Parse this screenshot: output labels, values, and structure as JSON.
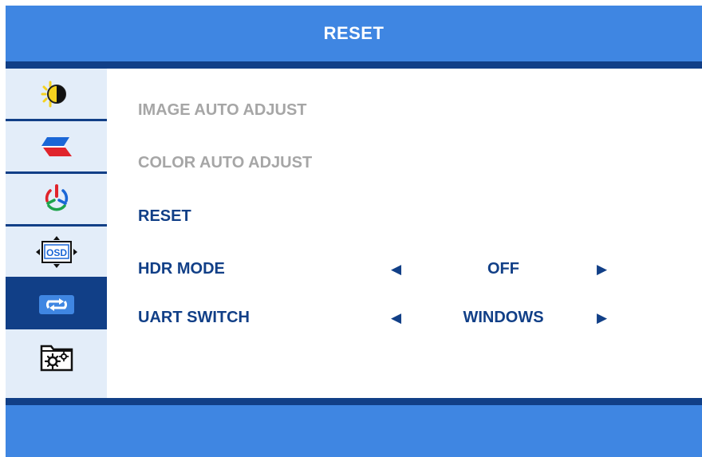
{
  "header": {
    "title": "RESET"
  },
  "sidebar": {
    "items": [
      {
        "icon": "brightness-contrast-icon",
        "active": false
      },
      {
        "icon": "color-icon",
        "active": false
      },
      {
        "icon": "rgb-power-icon",
        "active": false
      },
      {
        "icon": "osd-settings-icon",
        "active": false
      },
      {
        "icon": "reset-icon",
        "active": true
      },
      {
        "icon": "system-settings-icon",
        "active": false
      }
    ]
  },
  "menu": {
    "image_auto_adjust": "IMAGE AUTO ADJUST",
    "color_auto_adjust": "COLOR AUTO ADJUST",
    "reset": "RESET",
    "hdr_mode": {
      "label": "HDR MODE",
      "value": "OFF",
      "left_arrow": "◀",
      "right_arrow": "▶"
    },
    "uart_switch": {
      "label": "UART SWITCH",
      "value": "WINDOWS",
      "left_arrow": "◀",
      "right_arrow": "▶"
    }
  },
  "colors": {
    "header_bg": "#3f86e2",
    "dark_navy": "#113f87",
    "sidebar_bg": "#e3edf9",
    "disabled_text": "#a6a6a6"
  }
}
